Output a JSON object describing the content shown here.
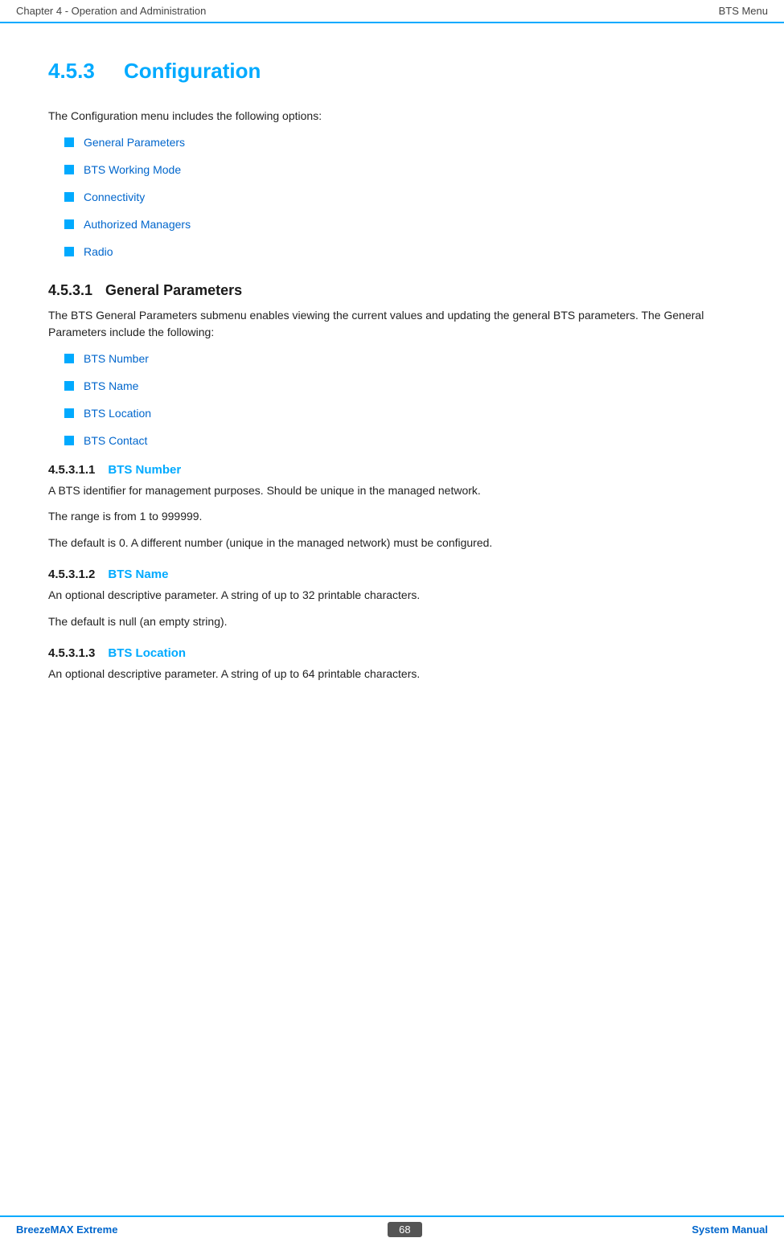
{
  "header": {
    "left": "Chapter 4 - Operation and Administration",
    "right": "BTS Menu"
  },
  "section": {
    "number": "4.5.3",
    "title": "Configuration",
    "intro": "The Configuration menu includes the following options:",
    "menu_items": [
      {
        "label": "General Parameters"
      },
      {
        "label": "BTS Working Mode"
      },
      {
        "label": "Connectivity"
      },
      {
        "label": "Authorized Managers"
      },
      {
        "label": "Radio"
      }
    ]
  },
  "subsection_1": {
    "number": "4.5.3.1",
    "title": "General Parameters",
    "intro": "The BTS General Parameters submenu enables viewing the current values and updating the general BTS parameters. The General Parameters include the following:",
    "items": [
      {
        "label": "BTS Number"
      },
      {
        "label": "BTS Name"
      },
      {
        "label": "BTS Location"
      },
      {
        "label": "BTS Contact"
      }
    ]
  },
  "subsection_1_1": {
    "number": "4.5.3.1.1",
    "title": "BTS Number",
    "paragraphs": [
      "A BTS identifier for management purposes. Should be unique in the managed network.",
      "The range is from 1 to 999999.",
      "The default is 0. A different number (unique in the managed network) must be configured."
    ]
  },
  "subsection_1_2": {
    "number": "4.5.3.1.2",
    "title": "BTS Name",
    "paragraphs": [
      "An optional descriptive parameter. A string of up to 32 printable characters.",
      "The default is null (an empty string)."
    ]
  },
  "subsection_1_3": {
    "number": "4.5.3.1.3",
    "title": "BTS Location",
    "paragraphs": [
      "An optional descriptive parameter. A string of up to 64 printable characters."
    ]
  },
  "footer": {
    "left": "BreezeMAX Extreme",
    "center": "68",
    "right": "System Manual"
  }
}
